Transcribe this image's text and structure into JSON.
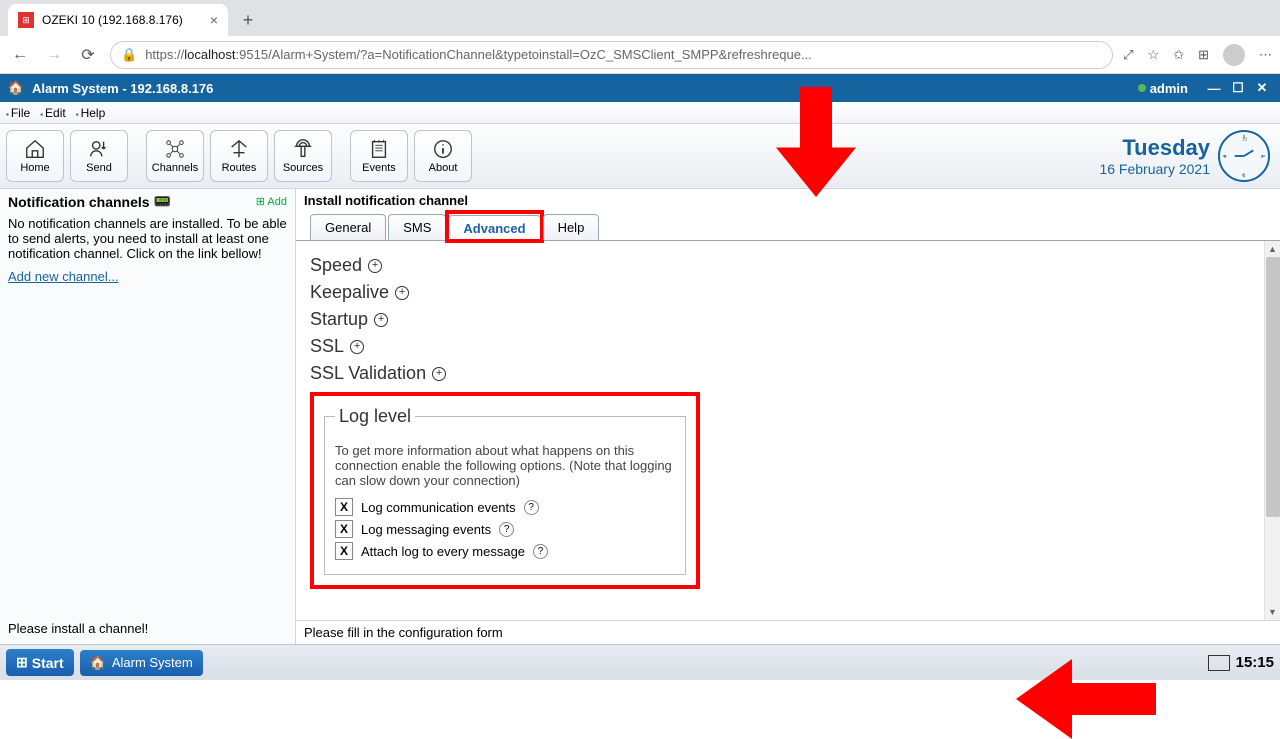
{
  "browser": {
    "tab_title": "OZEKI 10 (192.168.8.176)",
    "url_prefix": "https://",
    "url_host": "localhost",
    "url_rest": ":9515/Alarm+System/?a=NotificationChannel&typetoinstall=OzC_SMSClient_SMPP&refreshreque..."
  },
  "titlebar": {
    "app": "Alarm System - 192.168.8.176",
    "user": "admin"
  },
  "menu": {
    "file": "File",
    "edit": "Edit",
    "help": "Help"
  },
  "toolbar": {
    "home": "Home",
    "send": "Send",
    "channels": "Channels",
    "routes": "Routes",
    "sources": "Sources",
    "events": "Events",
    "about": "About"
  },
  "date": {
    "day": "Tuesday",
    "full": "16 February 2021"
  },
  "sidebar": {
    "title": "Notification channels",
    "add": "Add",
    "desc": "No notification channels are installed. To be able to send alerts, you need to install at least one notification channel. Click on the link bellow!",
    "link": "Add new channel...",
    "footer": "Please install a channel!"
  },
  "main": {
    "title": "Install notification channel",
    "tabs": {
      "general": "General",
      "sms": "SMS",
      "advanced": "Advanced",
      "help": "Help"
    },
    "sections": {
      "speed": "Speed",
      "keepalive": "Keepalive",
      "startup": "Startup",
      "ssl": "SSL",
      "sslval": "SSL Validation"
    },
    "loglevel": {
      "legend": "Log level",
      "desc": "To get more information about what happens on this connection enable the following options. (Note that logging can slow down your connection)",
      "opt1": "Log communication events",
      "opt2": "Log messaging events",
      "opt3": "Attach log to every message"
    },
    "footer": "Please fill in the configuration form"
  },
  "taskbar": {
    "start": "Start",
    "app": "Alarm System",
    "time": "15:15"
  }
}
